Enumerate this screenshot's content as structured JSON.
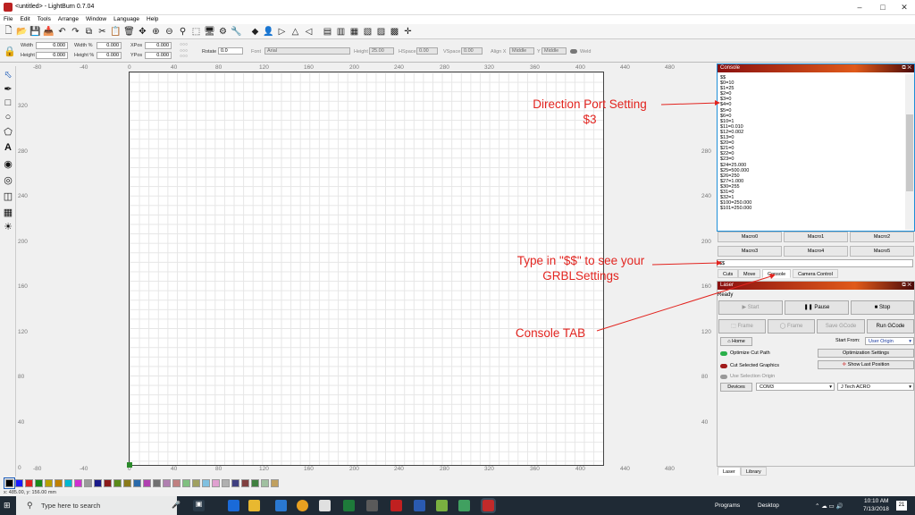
{
  "window": {
    "title": "<untitled> - LightBurn 0.7.04"
  },
  "menu": [
    "File",
    "Edit",
    "Tools",
    "Arrange",
    "Window",
    "Language",
    "Help"
  ],
  "props": {
    "width_label": "Width",
    "width_value": "0.000",
    "height_label": "Height",
    "height_value": "0.000",
    "width_pct_label": "Width %",
    "width_pct_value": "0.000",
    "height_pct_label": "Height %",
    "height_pct_value": "0.000",
    "xpos_label": "XPos",
    "xpos_value": "0.000",
    "ypos_label": "YPos",
    "ypos_value": "0.000",
    "rotate_label": "Rotate",
    "rotate_value": "0.0",
    "font_label": "Font",
    "font_value": "Arial",
    "fheight_label": "Height",
    "fheight_value": "25.00",
    "hspace_label": "HSpace",
    "hspace_value": "0.00",
    "vspace_label": "VSpace",
    "vspace_value": "0.00",
    "alignx_label": "Align X",
    "alignx_value": "Middle",
    "aligny_label": "Y",
    "aligny_value": "Middle",
    "weld_label": "Weld"
  },
  "rulers": {
    "x": [
      "-80",
      "-40",
      "0",
      "40",
      "80",
      "120",
      "160",
      "200",
      "240",
      "280",
      "320",
      "360",
      "400",
      "440",
      "480"
    ],
    "y": [
      "320",
      "280",
      "240",
      "200",
      "160",
      "120",
      "80",
      "40",
      "0"
    ]
  },
  "console": {
    "title": "Console",
    "lines": [
      "$$",
      "$0=10",
      "$1=25",
      "$2=0",
      "$3=0",
      "$4=0",
      "$5=0",
      "$6=0",
      "$10=1",
      "$11=0.010",
      "$12=0.002",
      "$13=0",
      "$20=0",
      "$21=0",
      "$22=0",
      "$23=0",
      "$24=25.000",
      "$25=500.000",
      "$26=250",
      "$27=1.000",
      "$30=255",
      "$31=0",
      "$32=1",
      "$100=250.000",
      "$101=250.000"
    ],
    "macros": [
      "Macro0",
      "Macro1",
      "Macro2",
      "Macro3",
      "Macro4",
      "Macro5"
    ],
    "input_value": "$$"
  },
  "tabs": [
    "Cuts",
    "Move",
    "Console",
    "Camera Control"
  ],
  "laser": {
    "title": "Laser",
    "status": "Ready",
    "start": "Start",
    "pause": "Pause",
    "stop": "Stop",
    "frame1": "Frame",
    "frame2": "Frame",
    "save_gcode": "Save GCode",
    "run_gcode": "Run GCode",
    "home": "Home",
    "start_from_label": "Start From:",
    "start_from_value": "User Origin",
    "optimize": "Optimize Cut Path",
    "opt_settings": "Optimization Settings",
    "cut_selected": "Cut Selected Graphics",
    "show_last": "Show Last Position",
    "use_selection": "Use Selection Origin",
    "devices": "Devices",
    "port": "COM3",
    "device": "J Tech ACRO"
  },
  "bottom_tabs": [
    "Laser",
    "Library"
  ],
  "annotations": {
    "direction": "Direction Port Setting\n$3",
    "type_in": "Type in \"$$\" to see your\nGRBLSettings",
    "console_tab": "Console TAB"
  },
  "palette": [
    "#000000",
    "#1a1aff",
    "#e02020",
    "#1a8a1a",
    "#b8a000",
    "#c08000",
    "#00b8d0",
    "#d030d0",
    "#9a9a9a",
    "#1a1a8a",
    "#8a1a1a",
    "#5a8a1a",
    "#8a7a1a",
    "#2a6aaa",
    "#b040b0",
    "#707070",
    "#b080b0",
    "#c08080",
    "#80c080",
    "#a0a060",
    "#80c0e0",
    "#e0a0d0",
    "#b0b0b0",
    "#404080",
    "#804040",
    "#408040",
    "#a0c0a0",
    "#c0a060"
  ],
  "coords": "x: 485.00, y: 156.00 mm",
  "taskbar": {
    "search": "Type here to search",
    "programs": "Programs",
    "desktop": "Desktop",
    "time": "10:10 AM",
    "date": "7/13/2018",
    "notif": "21"
  }
}
